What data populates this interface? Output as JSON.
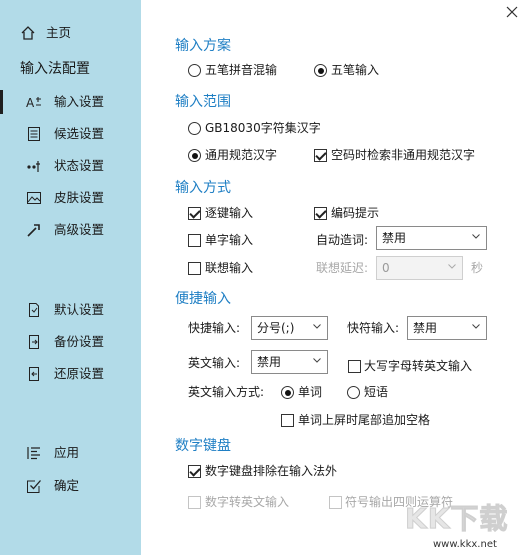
{
  "sidebar": {
    "home": "主页",
    "heading": "输入法配置",
    "items": [
      {
        "label": "输入设置",
        "icon": "input-settings-icon",
        "active": true
      },
      {
        "label": "候选设置",
        "icon": "candidate-settings-icon",
        "active": false
      },
      {
        "label": "状态设置",
        "icon": "status-settings-icon",
        "active": false
      },
      {
        "label": "皮肤设置",
        "icon": "skin-settings-icon",
        "active": false
      },
      {
        "label": "高级设置",
        "icon": "advanced-settings-icon",
        "active": false
      }
    ],
    "bottom_items": [
      {
        "label": "默认设置",
        "icon": "default-settings-icon"
      },
      {
        "label": "备份设置",
        "icon": "backup-settings-icon"
      },
      {
        "label": "还原设置",
        "icon": "restore-settings-icon"
      }
    ],
    "apply": "应用",
    "ok": "确定"
  },
  "scheme": {
    "title": "输入方案",
    "opt1": "五笔拼音混输",
    "opt2": "五笔输入",
    "selected": "五笔输入"
  },
  "range": {
    "title": "输入范围",
    "opt1": "GB18030字符集汉字",
    "opt2": "通用规范汉字",
    "selected": "通用规范汉字",
    "check_extra": "空码时检索非通用规范汉字",
    "check_extra_on": true
  },
  "method": {
    "title": "输入方式",
    "zhujian": "逐键输入",
    "zhujian_on": true,
    "bianma": "编码提示",
    "bianma_on": true,
    "danzi": "单字输入",
    "danzi_on": false,
    "auto_word_label": "自动造词:",
    "auto_word_value": "禁用",
    "lianxiang": "联想输入",
    "lianxiang_on": false,
    "delay_label": "联想延迟:",
    "delay_value": "0",
    "delay_unit": "秒"
  },
  "quick": {
    "title": "便捷输入",
    "quick_label": "快捷输入:",
    "quick_value": "分号(;)",
    "fast_label": "快符输入:",
    "fast_value": "禁用",
    "english_label": "英文输入:",
    "english_value": "禁用",
    "caps_label": "大写字母转英文输入",
    "caps_on": false,
    "english_mode_label": "英文输入方式:",
    "mode_word": "单词",
    "mode_phrase": "短语",
    "mode_selected": "单词",
    "space_label": "单词上屏时尾部追加空格",
    "space_on": false
  },
  "numpad": {
    "title": "数字键盘",
    "exclude": "数字键盘排除在输入法外",
    "exclude_on": true,
    "to_english": "数字转英文输入",
    "symbol_calc": "符号输出四则运算符"
  },
  "watermark": {
    "text": "KK下载",
    "url": "www.kkx.net"
  }
}
